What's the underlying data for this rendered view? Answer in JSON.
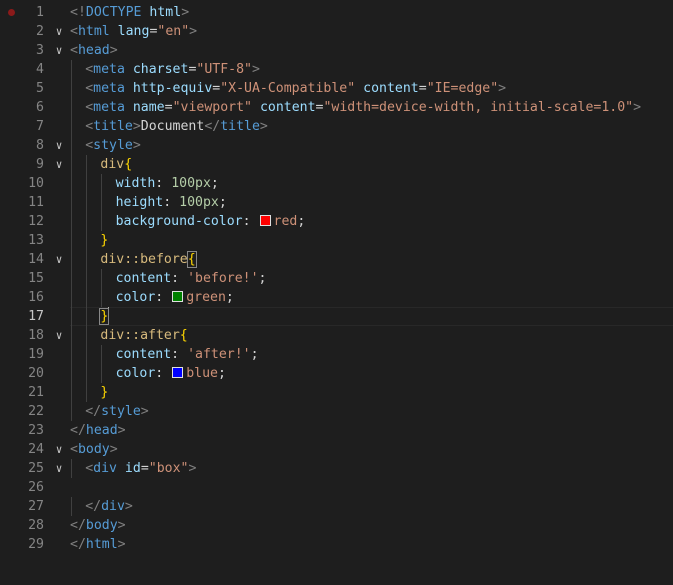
{
  "editor": {
    "current_line": 17,
    "colors": {
      "red": "#ff0000",
      "green": "#008000",
      "blue": "#0000ff"
    },
    "lines": [
      {
        "n": "1",
        "indent": 0,
        "fold": "",
        "tokens": [
          [
            "tk-punc",
            "<!"
          ],
          [
            "tk-tag",
            "DOCTYPE"
          ],
          [
            "tk-text",
            " "
          ],
          [
            "tk-attr",
            "html"
          ],
          [
            "tk-punc",
            ">"
          ]
        ]
      },
      {
        "n": "2",
        "indent": 0,
        "fold": "v",
        "tokens": [
          [
            "tk-punc",
            "<"
          ],
          [
            "tk-tag",
            "html"
          ],
          [
            "tk-text",
            " "
          ],
          [
            "tk-attr",
            "lang"
          ],
          [
            "tk-text",
            "="
          ],
          [
            "tk-str",
            "\"en\""
          ],
          [
            "tk-punc",
            ">"
          ]
        ]
      },
      {
        "n": "3",
        "indent": 0,
        "fold": "v",
        "tokens": [
          [
            "tk-punc",
            "<"
          ],
          [
            "tk-tag",
            "head"
          ],
          [
            "tk-punc",
            ">"
          ]
        ]
      },
      {
        "n": "4",
        "indent": 1,
        "fold": "",
        "tokens": [
          [
            "tk-punc",
            "<"
          ],
          [
            "tk-tag",
            "meta"
          ],
          [
            "tk-text",
            " "
          ],
          [
            "tk-attr",
            "charset"
          ],
          [
            "tk-text",
            "="
          ],
          [
            "tk-str",
            "\"UTF-8\""
          ],
          [
            "tk-punc",
            ">"
          ]
        ]
      },
      {
        "n": "5",
        "indent": 1,
        "fold": "",
        "tokens": [
          [
            "tk-punc",
            "<"
          ],
          [
            "tk-tag",
            "meta"
          ],
          [
            "tk-text",
            " "
          ],
          [
            "tk-attr",
            "http-equiv"
          ],
          [
            "tk-text",
            "="
          ],
          [
            "tk-str",
            "\"X-UA-Compatible\""
          ],
          [
            "tk-text",
            " "
          ],
          [
            "tk-attr",
            "content"
          ],
          [
            "tk-text",
            "="
          ],
          [
            "tk-str",
            "\"IE=edge\""
          ],
          [
            "tk-punc",
            ">"
          ]
        ]
      },
      {
        "n": "6",
        "indent": 1,
        "fold": "",
        "tokens": [
          [
            "tk-punc",
            "<"
          ],
          [
            "tk-tag",
            "meta"
          ],
          [
            "tk-text",
            " "
          ],
          [
            "tk-attr",
            "name"
          ],
          [
            "tk-text",
            "="
          ],
          [
            "tk-str",
            "\"viewport\""
          ],
          [
            "tk-text",
            " "
          ],
          [
            "tk-attr",
            "content"
          ],
          [
            "tk-text",
            "="
          ],
          [
            "tk-str",
            "\"width=device-width, initial-scale=1.0\""
          ],
          [
            "tk-punc",
            ">"
          ]
        ]
      },
      {
        "n": "7",
        "indent": 1,
        "fold": "",
        "tokens": [
          [
            "tk-punc",
            "<"
          ],
          [
            "tk-tag",
            "title"
          ],
          [
            "tk-punc",
            ">"
          ],
          [
            "tk-text",
            "Document"
          ],
          [
            "tk-punc",
            "</"
          ],
          [
            "tk-tag",
            "title"
          ],
          [
            "tk-punc",
            ">"
          ]
        ]
      },
      {
        "n": "8",
        "indent": 1,
        "fold": "v",
        "tokens": [
          [
            "tk-punc",
            "<"
          ],
          [
            "tk-tag",
            "style"
          ],
          [
            "tk-punc",
            ">"
          ]
        ]
      },
      {
        "n": "9",
        "indent": 2,
        "fold": "v",
        "tokens": [
          [
            "tk-sel",
            "div"
          ],
          [
            "tk-brace",
            "{"
          ]
        ]
      },
      {
        "n": "10",
        "indent": 3,
        "fold": "",
        "tokens": [
          [
            "tk-prop",
            "width"
          ],
          [
            "tk-text",
            ": "
          ],
          [
            "tk-num",
            "100px"
          ],
          [
            "tk-text",
            ";"
          ]
        ]
      },
      {
        "n": "11",
        "indent": 3,
        "fold": "",
        "tokens": [
          [
            "tk-prop",
            "height"
          ],
          [
            "tk-text",
            ": "
          ],
          [
            "tk-num",
            "100px"
          ],
          [
            "tk-text",
            ";"
          ]
        ]
      },
      {
        "n": "12",
        "indent": 3,
        "fold": "",
        "tokens": [
          [
            "tk-prop",
            "background-color"
          ],
          [
            "tk-text",
            ": "
          ],
          [
            "swatch",
            "red"
          ],
          [
            "tk-kw",
            "red"
          ],
          [
            "tk-text",
            ";"
          ]
        ]
      },
      {
        "n": "13",
        "indent": 2,
        "fold": "",
        "tokens": [
          [
            "tk-brace",
            "}"
          ]
        ]
      },
      {
        "n": "14",
        "indent": 2,
        "fold": "v",
        "tokens": [
          [
            "tk-sel",
            "div::before"
          ],
          [
            "tk-brace-hl",
            "{"
          ]
        ]
      },
      {
        "n": "15",
        "indent": 3,
        "fold": "",
        "tokens": [
          [
            "tk-prop",
            "content"
          ],
          [
            "tk-text",
            ": "
          ],
          [
            "tk-str",
            "'before!'"
          ],
          [
            "tk-text",
            ";"
          ]
        ]
      },
      {
        "n": "16",
        "indent": 3,
        "fold": "",
        "tokens": [
          [
            "tk-prop",
            "color"
          ],
          [
            "tk-text",
            ": "
          ],
          [
            "swatch",
            "green"
          ],
          [
            "tk-kw",
            "green"
          ],
          [
            "tk-text",
            ";"
          ]
        ]
      },
      {
        "n": "17",
        "indent": 2,
        "fold": "",
        "tokens": [
          [
            "tk-brace-hl",
            "}"
          ],
          [
            "caret",
            ""
          ]
        ]
      },
      {
        "n": "18",
        "indent": 2,
        "fold": "v",
        "tokens": [
          [
            "tk-sel",
            "div::after"
          ],
          [
            "tk-brace",
            "{"
          ]
        ]
      },
      {
        "n": "19",
        "indent": 3,
        "fold": "",
        "tokens": [
          [
            "tk-prop",
            "content"
          ],
          [
            "tk-text",
            ": "
          ],
          [
            "tk-str",
            "'after!'"
          ],
          [
            "tk-text",
            ";"
          ]
        ]
      },
      {
        "n": "20",
        "indent": 3,
        "fold": "",
        "tokens": [
          [
            "tk-prop",
            "color"
          ],
          [
            "tk-text",
            ": "
          ],
          [
            "swatch",
            "blue"
          ],
          [
            "tk-kw",
            "blue"
          ],
          [
            "tk-text",
            ";"
          ]
        ]
      },
      {
        "n": "21",
        "indent": 2,
        "fold": "",
        "tokens": [
          [
            "tk-brace",
            "}"
          ]
        ]
      },
      {
        "n": "22",
        "indent": 1,
        "fold": "",
        "tokens": [
          [
            "tk-punc",
            "</"
          ],
          [
            "tk-tag",
            "style"
          ],
          [
            "tk-punc",
            ">"
          ]
        ]
      },
      {
        "n": "23",
        "indent": 0,
        "fold": "",
        "tokens": [
          [
            "tk-punc",
            "</"
          ],
          [
            "tk-tag",
            "head"
          ],
          [
            "tk-punc",
            ">"
          ]
        ]
      },
      {
        "n": "24",
        "indent": 0,
        "fold": "v",
        "tokens": [
          [
            "tk-punc",
            "<"
          ],
          [
            "tk-tag",
            "body"
          ],
          [
            "tk-punc",
            ">"
          ]
        ]
      },
      {
        "n": "25",
        "indent": 1,
        "fold": "v",
        "tokens": [
          [
            "tk-punc",
            "<"
          ],
          [
            "tk-tag",
            "div"
          ],
          [
            "tk-text",
            " "
          ],
          [
            "tk-attr",
            "id"
          ],
          [
            "tk-text",
            "="
          ],
          [
            "tk-str",
            "\"box\""
          ],
          [
            "tk-punc",
            ">"
          ]
        ]
      },
      {
        "n": "26",
        "indent": 0,
        "fold": "",
        "tokens": []
      },
      {
        "n": "27",
        "indent": 1,
        "fold": "",
        "tokens": [
          [
            "tk-punc",
            "</"
          ],
          [
            "tk-tag",
            "div"
          ],
          [
            "tk-punc",
            ">"
          ]
        ]
      },
      {
        "n": "28",
        "indent": 0,
        "fold": "",
        "tokens": [
          [
            "tk-punc",
            "</"
          ],
          [
            "tk-tag",
            "body"
          ],
          [
            "tk-punc",
            ">"
          ]
        ]
      },
      {
        "n": "29",
        "indent": 0,
        "fold": "",
        "tokens": [
          [
            "tk-punc",
            "</"
          ],
          [
            "tk-tag",
            "html"
          ],
          [
            "tk-punc",
            ">"
          ]
        ]
      }
    ]
  }
}
